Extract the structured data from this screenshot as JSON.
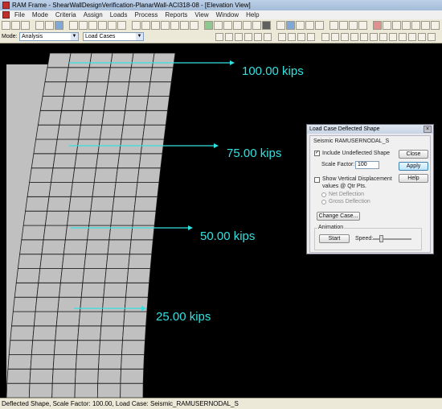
{
  "window": {
    "title": "RAM Frame - ShearWallDesignVerification-PlanarWall-ACI318-08 - [Elevation View]"
  },
  "menu": [
    "File",
    "Mode",
    "Criteria",
    "Assign",
    "Loads",
    "Process",
    "Reports",
    "View",
    "Window",
    "Help"
  ],
  "toolbar2": {
    "mode_label": "Mode:",
    "mode_value": "Analysis",
    "loadcases_value": "Load Cases"
  },
  "view": {
    "load_labels": [
      "100.00 kips",
      "75.00 kips",
      "50.00 kips",
      "25.00 kips"
    ],
    "arrow_color": "#33e0e0",
    "mesh_fill": "#c0c0c0",
    "background": "#000000"
  },
  "dialog": {
    "title": "Load Case Deflected Shape",
    "load_case": "Seismic RAMUSERNODAL_S",
    "include_undeflected_label": "Include Undeflected Shape",
    "include_undeflected_checked": true,
    "scale_factor_label": "Scale Factor:",
    "scale_factor_value": "100",
    "show_vertical_label_line1": "Show Vertical Displacement",
    "show_vertical_label_line2": "values @ Qtr Pts.",
    "show_vertical_checked": false,
    "net_deflection_label": "Net Deflection",
    "gross_deflection_label": "Gross Deflection",
    "change_case_label": "Change Case...",
    "animation_label": "Animation",
    "start_label": "Start",
    "speed_label": "Speed:",
    "close_label": "Close",
    "apply_label": "Apply",
    "help_label": "Help",
    "speed_level": 0.2
  },
  "status": {
    "text": "Deflected Shape, Scale Factor: 100.00, Load Case: Seismic_RAMUSERNODAL_S"
  }
}
